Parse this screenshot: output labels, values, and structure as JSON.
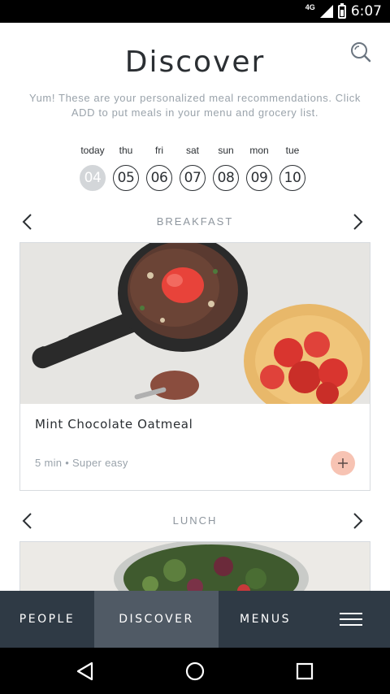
{
  "status_bar": {
    "network": "4G",
    "time": "6:07",
    "icons": [
      "signal-icon",
      "battery-icon"
    ]
  },
  "header": {
    "title": "Discover",
    "subtitle": "Yum! These are your personalized meal recommendations. Click ADD to put meals in your menu and grocery list.",
    "search_icon": "search-icon"
  },
  "days": [
    {
      "name": "today",
      "num": "04",
      "active": true
    },
    {
      "name": "thu",
      "num": "05",
      "active": false
    },
    {
      "name": "fri",
      "num": "06",
      "active": false
    },
    {
      "name": "sat",
      "num": "07",
      "active": false
    },
    {
      "name": "sun",
      "num": "08",
      "active": false
    },
    {
      "name": "mon",
      "num": "09",
      "active": false
    },
    {
      "name": "tue",
      "num": "10",
      "active": false
    }
  ],
  "sections": [
    {
      "label": "BREAKFAST",
      "meal": {
        "title": "Mint Chocolate Oatmeal",
        "meta": "5 min • Super easy",
        "add_icon": "plus-icon"
      }
    },
    {
      "label": "LUNCH"
    }
  ],
  "bottom_nav": {
    "items": [
      "PEOPLE",
      "DISCOVER",
      "MENUS"
    ],
    "active": "DISCOVER",
    "menu_icon": "hamburger-icon"
  },
  "system_nav": [
    "back-icon",
    "home-icon",
    "recents-icon"
  ],
  "colors": {
    "accent": "#f7c3b3",
    "nav_bg": "#2f3a45",
    "nav_active": "#505a65"
  }
}
